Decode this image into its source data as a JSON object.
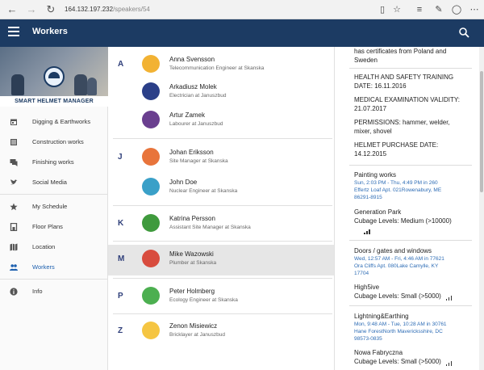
{
  "browser": {
    "url_host": "164.132.197.232",
    "url_path": "/speakers/54"
  },
  "appbar": {
    "title": "Workers"
  },
  "logo": {
    "text": "SMART HELMET MANAGER"
  },
  "sidebar": {
    "items": [
      {
        "label": "Digging & Earthworks",
        "icon": "calendar-icon"
      },
      {
        "label": "Construction works",
        "icon": "list-icon"
      },
      {
        "label": "Finishing works",
        "icon": "chat-icon"
      },
      {
        "label": "Social Media",
        "icon": "twitter-icon"
      },
      {
        "label": "My Schedule",
        "icon": "star-icon"
      },
      {
        "label": "Floor Plans",
        "icon": "layers-icon"
      },
      {
        "label": "Location",
        "icon": "map-icon"
      },
      {
        "label": "Workers",
        "icon": "people-icon"
      },
      {
        "label": "Info",
        "icon": "info-icon"
      }
    ],
    "active_color": "#1c5fae"
  },
  "workers": [
    {
      "letter": "A",
      "name": "Anna Svensson",
      "role": "Telecommunication Engineer at Skanska",
      "avatar": "#f2b233"
    },
    {
      "letter": "",
      "name": "Arkadiusz Molek",
      "role": "Electrician at Januszbud",
      "avatar": "#2b3f88"
    },
    {
      "letter": "",
      "name": "Artur Zamek",
      "role": "Labourer at Januszbud",
      "avatar": "#6a3f8f"
    },
    {
      "letter": "J",
      "name": "Johan Eriksson",
      "role": "Site Manager at Skanska",
      "avatar": "#e8743b"
    },
    {
      "letter": "",
      "name": "John Doe",
      "role": "Nuclear Engineer at Skanska",
      "avatar": "#3aa0c8"
    },
    {
      "letter": "K",
      "name": "Katrina Persson",
      "role": "Assistant Site Manager at Skanska",
      "avatar": "#3f9a3d"
    },
    {
      "letter": "M",
      "name": "Mike Wazowski",
      "role": "Plumber at Skanska",
      "avatar": "#d84c3e"
    },
    {
      "letter": "P",
      "name": "Peter Holmberg",
      "role": "Ecology Engineer at Skanska",
      "avatar": "#4caf50"
    },
    {
      "letter": "Z",
      "name": "Zenon Misiewicz",
      "role": "Bricklayer at Januszbud",
      "avatar": "#f5c542"
    }
  ],
  "detail": {
    "top_line1": "has certificates from Poland and",
    "top_line2": "Sweden",
    "health_line1": "HEALTH AND SAFETY TRAINING",
    "health_line2": "DATE: 16.11.2016",
    "medical_line1": "MEDICAL EXAMINATION VALIDITY:",
    "medical_line2": "21.07.2017",
    "perm_line1": "PERMISSIONS: hammer, welder,",
    "perm_line2": "mixer, shovel",
    "helmet_line1": "HELMET PURCHASE DATE:",
    "helmet_line2": "14.12.2015",
    "sessions": [
      {
        "title": "Painting works",
        "time": "Sun, 2:03 PM - Thu, 4:49 PM in 260",
        "addr1": "Effertz Loaf Apt. 021Rowenabury, ME",
        "addr2": "86291-8915",
        "extra": []
      },
      {
        "title": "Generation Park",
        "level": "Cubage Levels: Medium (>10000)"
      },
      {
        "title": "Doors / gates and windows",
        "time": "Wed, 12:57 AM - Fri, 4:46 AM in 77621",
        "addr1": "Ora Cliffs Apt. 080Lake Camylle, KY",
        "addr2": "17704"
      },
      {
        "title": "High5ive",
        "level": "Cubage Levels: Small (>5000)"
      },
      {
        "title": "Lightning&Earthing",
        "time": "Mon, 9:48 AM - Tue, 10:28 AM in 30761",
        "addr1": "Hane ForestNorth Mavericksshire, DC",
        "addr2": "98573-0835"
      },
      {
        "title": "Nowa Fabryczna",
        "level": "Cubage Levels: Small (>5000)"
      }
    ]
  }
}
